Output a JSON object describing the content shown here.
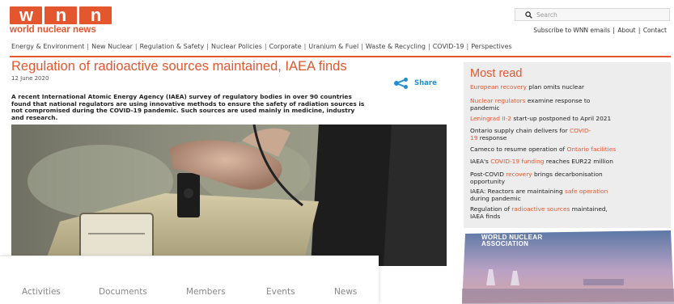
{
  "logo": {
    "letters": [
      "w",
      "n",
      "n"
    ],
    "subtitle": "world nuclear news"
  },
  "search": {
    "placeholder": "Search",
    "icon": "search-icon"
  },
  "top_links": [
    "Subscribe to WNN emails",
    "About",
    "Contact"
  ],
  "nav": [
    "Energy & Environment",
    "New Nuclear",
    "Regulation & Safety",
    "Nuclear Policies",
    "Corporate",
    "Uranium & Fuel",
    "Waste & Recycling",
    "COVID-19",
    "Perspectives"
  ],
  "article": {
    "title": "Regulation of radioactive sources maintained, IAEA finds",
    "date": "12 June 2020",
    "share_label": "Share",
    "lead_lines": [
      "A recent International Atomic Energy Agency (IAEA) survey of regulatory bodies in over 90 countries",
      "found that national regulators are using innovative methods to ensure the safety of radiation sources is",
      "not compromised during the COVID-19 pandemic. Such sources are used mainly in medicine, industry",
      "and research."
    ]
  },
  "menu": [
    "Activities",
    "Documents",
    "Members",
    "Events",
    "News"
  ],
  "most_read": {
    "title": "Most read",
    "items": [
      {
        "lines": [
          [
            [
              "European recovery",
              true
            ],
            [
              " plan omits nuclear",
              false
            ]
          ]
        ]
      },
      {
        "lines": [
          [
            [
              "Nuclear regulators",
              true
            ],
            [
              " examine response to",
              false
            ]
          ],
          [
            [
              "pandemic",
              false
            ]
          ]
        ]
      },
      {
        "lines": [
          [
            [
              "Leningrad II-2",
              true
            ],
            [
              " start-up postponed to April 2021",
              false
            ]
          ]
        ]
      },
      {
        "lines": [
          [
            [
              "Ontario supply chain delivers for ",
              false
            ],
            [
              "COVID-",
              true
            ]
          ],
          [
            [
              "19",
              true
            ],
            [
              " response",
              false
            ]
          ]
        ]
      },
      {
        "lines": [
          [
            [
              "Cameco to resume operation of ",
              false
            ],
            [
              "Ontario facilities",
              true
            ]
          ]
        ]
      },
      {
        "lines": [
          [
            [
              "IAEA's ",
              false
            ],
            [
              "COVID-19 funding",
              true
            ],
            [
              " reaches EUR22 million",
              false
            ]
          ]
        ]
      },
      {
        "lines": [
          [
            [
              "Post-COVID ",
              false
            ],
            [
              "recovery",
              true
            ],
            [
              " brings decarbonisation",
              false
            ]
          ],
          [
            [
              "opportunity",
              false
            ]
          ]
        ]
      },
      {
        "lines": [
          [
            [
              "IAEA: Reactors are maintaining ",
              false
            ],
            [
              "safe operation",
              true
            ]
          ],
          [
            [
              "during pandemic",
              false
            ]
          ]
        ]
      },
      {
        "lines": [
          [
            [
              "Regulation of ",
              false
            ],
            [
              "radioactive sources",
              true
            ],
            [
              " maintained,",
              false
            ]
          ],
          [
            [
              "IAEA finds",
              false
            ]
          ]
        ]
      }
    ]
  },
  "banner": {
    "lines": [
      "WORLD NUCLEAR",
      "ASSOCIATION"
    ]
  },
  "colors": {
    "accent": "#e4572e",
    "share": "#1f8fd6",
    "sidebar_bg": "#ededed"
  }
}
